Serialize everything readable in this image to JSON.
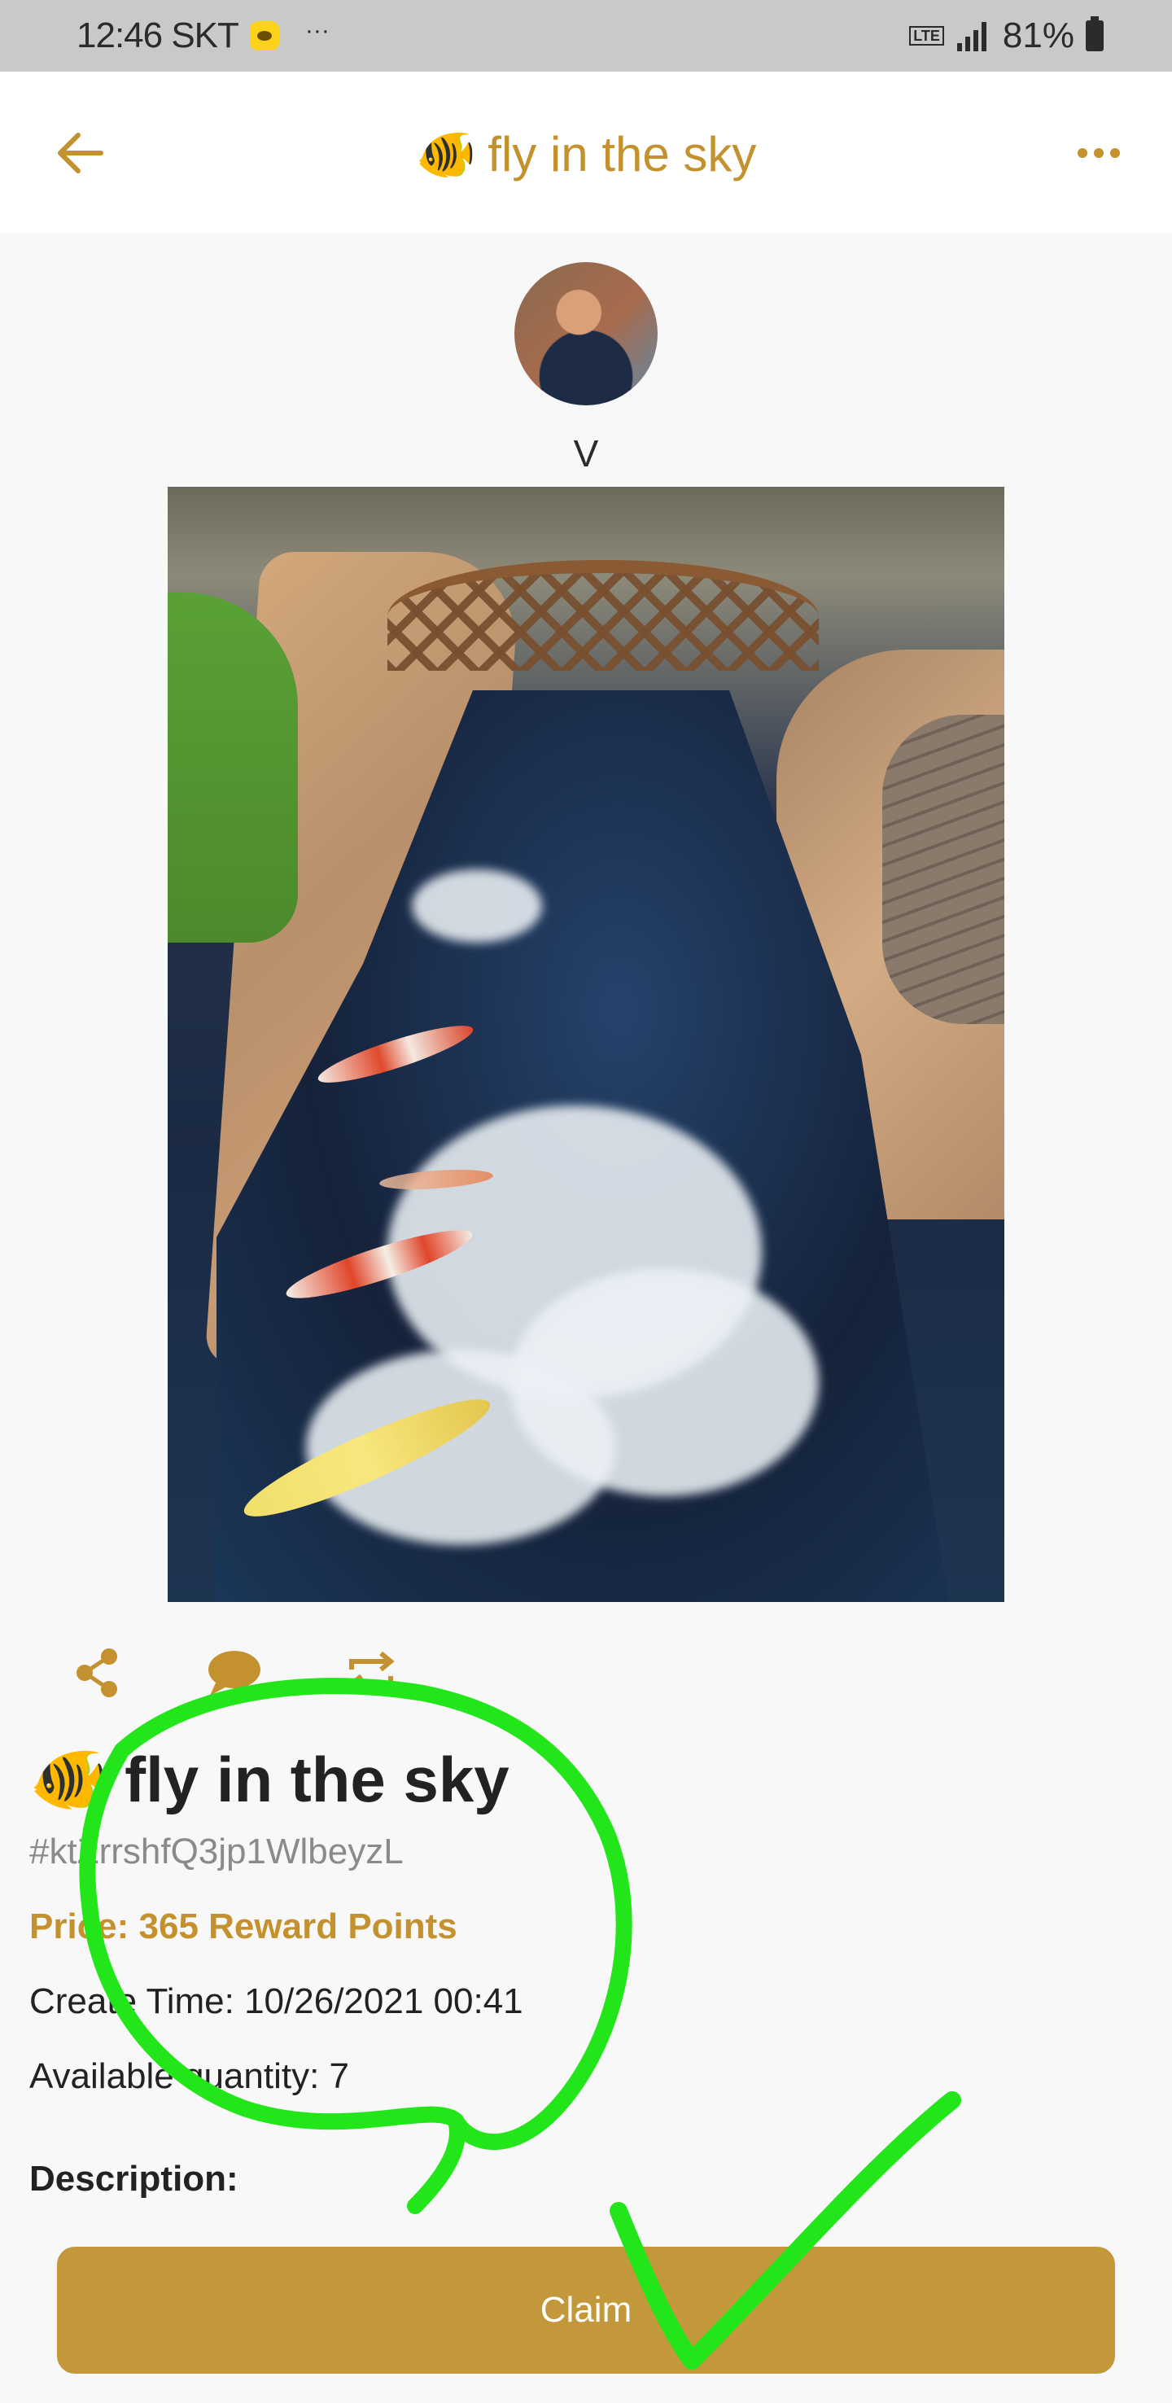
{
  "status_bar": {
    "time": "12:46 SKT",
    "notification_icon": "kakaotalk-icon",
    "overflow": "···",
    "network": "LTE",
    "battery": "81%"
  },
  "header": {
    "title_emoji": "🐠",
    "title": "fly in the sky",
    "back_icon": "arrow-left-icon",
    "more_icon": "more-horizontal-icon"
  },
  "author": {
    "name": "V"
  },
  "actions": {
    "share_icon": "share-icon",
    "comment_icon": "comment-icon",
    "repost_icon": "repost-icon"
  },
  "item": {
    "emoji": "🐠",
    "title": "fly in the sky",
    "id": "#ktZrrshfQ3jp1WlbeyzL",
    "price": "Price: 365 Reward Points",
    "create_time": "Create Time: 10/26/2021 00:41",
    "available_quantity": "Available quantity: 7",
    "description_label": "Description:"
  },
  "claim_button": {
    "label": "Claim"
  },
  "colors": {
    "accent": "#c3922e",
    "button": "#c3983b",
    "annotation": "#22e61a"
  }
}
